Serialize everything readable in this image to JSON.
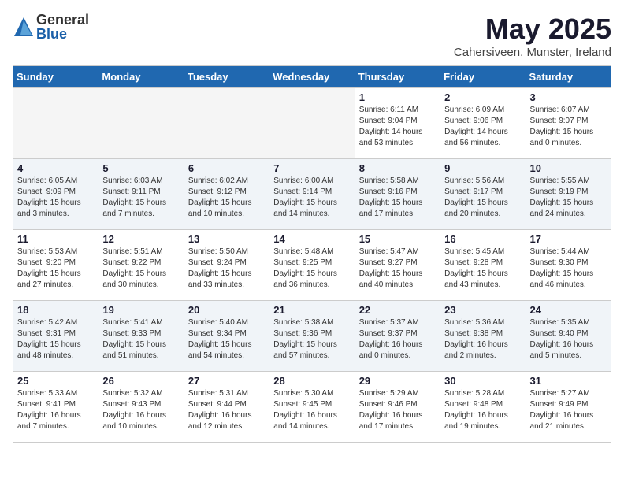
{
  "logo": {
    "general": "General",
    "blue": "Blue"
  },
  "title": "May 2025",
  "subtitle": "Cahersiveen, Munster, Ireland",
  "weekdays": [
    "Sunday",
    "Monday",
    "Tuesday",
    "Wednesday",
    "Thursday",
    "Friday",
    "Saturday"
  ],
  "weeks": [
    [
      {
        "day": "",
        "info": ""
      },
      {
        "day": "",
        "info": ""
      },
      {
        "day": "",
        "info": ""
      },
      {
        "day": "",
        "info": ""
      },
      {
        "day": "1",
        "info": "Sunrise: 6:11 AM\nSunset: 9:04 PM\nDaylight: 14 hours\nand 53 minutes."
      },
      {
        "day": "2",
        "info": "Sunrise: 6:09 AM\nSunset: 9:06 PM\nDaylight: 14 hours\nand 56 minutes."
      },
      {
        "day": "3",
        "info": "Sunrise: 6:07 AM\nSunset: 9:07 PM\nDaylight: 15 hours\nand 0 minutes."
      }
    ],
    [
      {
        "day": "4",
        "info": "Sunrise: 6:05 AM\nSunset: 9:09 PM\nDaylight: 15 hours\nand 3 minutes."
      },
      {
        "day": "5",
        "info": "Sunrise: 6:03 AM\nSunset: 9:11 PM\nDaylight: 15 hours\nand 7 minutes."
      },
      {
        "day": "6",
        "info": "Sunrise: 6:02 AM\nSunset: 9:12 PM\nDaylight: 15 hours\nand 10 minutes."
      },
      {
        "day": "7",
        "info": "Sunrise: 6:00 AM\nSunset: 9:14 PM\nDaylight: 15 hours\nand 14 minutes."
      },
      {
        "day": "8",
        "info": "Sunrise: 5:58 AM\nSunset: 9:16 PM\nDaylight: 15 hours\nand 17 minutes."
      },
      {
        "day": "9",
        "info": "Sunrise: 5:56 AM\nSunset: 9:17 PM\nDaylight: 15 hours\nand 20 minutes."
      },
      {
        "day": "10",
        "info": "Sunrise: 5:55 AM\nSunset: 9:19 PM\nDaylight: 15 hours\nand 24 minutes."
      }
    ],
    [
      {
        "day": "11",
        "info": "Sunrise: 5:53 AM\nSunset: 9:20 PM\nDaylight: 15 hours\nand 27 minutes."
      },
      {
        "day": "12",
        "info": "Sunrise: 5:51 AM\nSunset: 9:22 PM\nDaylight: 15 hours\nand 30 minutes."
      },
      {
        "day": "13",
        "info": "Sunrise: 5:50 AM\nSunset: 9:24 PM\nDaylight: 15 hours\nand 33 minutes."
      },
      {
        "day": "14",
        "info": "Sunrise: 5:48 AM\nSunset: 9:25 PM\nDaylight: 15 hours\nand 36 minutes."
      },
      {
        "day": "15",
        "info": "Sunrise: 5:47 AM\nSunset: 9:27 PM\nDaylight: 15 hours\nand 40 minutes."
      },
      {
        "day": "16",
        "info": "Sunrise: 5:45 AM\nSunset: 9:28 PM\nDaylight: 15 hours\nand 43 minutes."
      },
      {
        "day": "17",
        "info": "Sunrise: 5:44 AM\nSunset: 9:30 PM\nDaylight: 15 hours\nand 46 minutes."
      }
    ],
    [
      {
        "day": "18",
        "info": "Sunrise: 5:42 AM\nSunset: 9:31 PM\nDaylight: 15 hours\nand 48 minutes."
      },
      {
        "day": "19",
        "info": "Sunrise: 5:41 AM\nSunset: 9:33 PM\nDaylight: 15 hours\nand 51 minutes."
      },
      {
        "day": "20",
        "info": "Sunrise: 5:40 AM\nSunset: 9:34 PM\nDaylight: 15 hours\nand 54 minutes."
      },
      {
        "day": "21",
        "info": "Sunrise: 5:38 AM\nSunset: 9:36 PM\nDaylight: 15 hours\nand 57 minutes."
      },
      {
        "day": "22",
        "info": "Sunrise: 5:37 AM\nSunset: 9:37 PM\nDaylight: 16 hours\nand 0 minutes."
      },
      {
        "day": "23",
        "info": "Sunrise: 5:36 AM\nSunset: 9:38 PM\nDaylight: 16 hours\nand 2 minutes."
      },
      {
        "day": "24",
        "info": "Sunrise: 5:35 AM\nSunset: 9:40 PM\nDaylight: 16 hours\nand 5 minutes."
      }
    ],
    [
      {
        "day": "25",
        "info": "Sunrise: 5:33 AM\nSunset: 9:41 PM\nDaylight: 16 hours\nand 7 minutes."
      },
      {
        "day": "26",
        "info": "Sunrise: 5:32 AM\nSunset: 9:43 PM\nDaylight: 16 hours\nand 10 minutes."
      },
      {
        "day": "27",
        "info": "Sunrise: 5:31 AM\nSunset: 9:44 PM\nDaylight: 16 hours\nand 12 minutes."
      },
      {
        "day": "28",
        "info": "Sunrise: 5:30 AM\nSunset: 9:45 PM\nDaylight: 16 hours\nand 14 minutes."
      },
      {
        "day": "29",
        "info": "Sunrise: 5:29 AM\nSunset: 9:46 PM\nDaylight: 16 hours\nand 17 minutes."
      },
      {
        "day": "30",
        "info": "Sunrise: 5:28 AM\nSunset: 9:48 PM\nDaylight: 16 hours\nand 19 minutes."
      },
      {
        "day": "31",
        "info": "Sunrise: 5:27 AM\nSunset: 9:49 PM\nDaylight: 16 hours\nand 21 minutes."
      }
    ]
  ]
}
